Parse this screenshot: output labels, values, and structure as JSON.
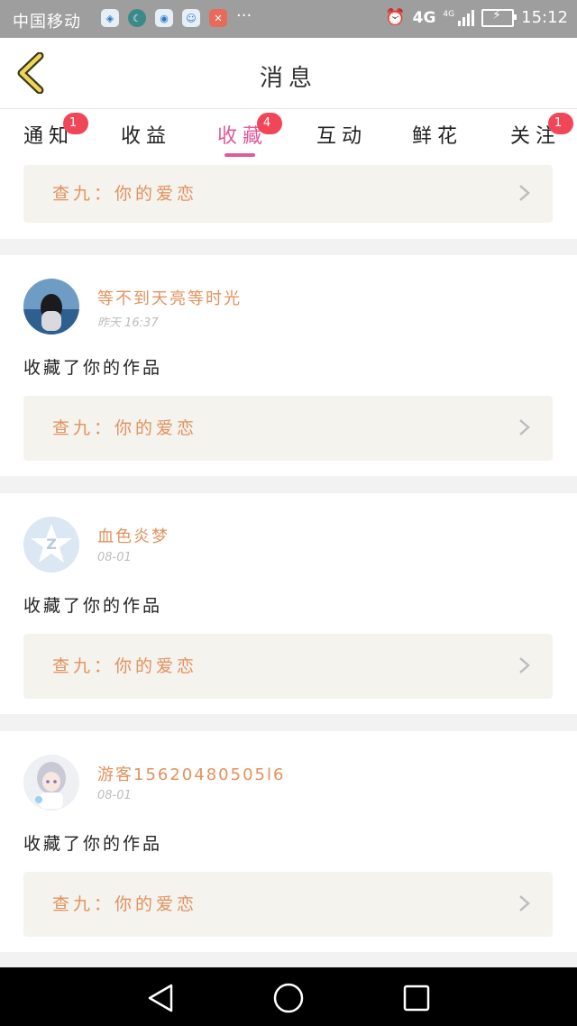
{
  "status_bar": {
    "carrier": "中国移动",
    "network": "4G",
    "network_small": "4G",
    "time": "15:12"
  },
  "header": {
    "title": "消息"
  },
  "tabs": [
    {
      "label": "通知",
      "badge": "1"
    },
    {
      "label": "收益",
      "badge": ""
    },
    {
      "label": "收藏",
      "badge": "4",
      "active": true
    },
    {
      "label": "互动",
      "badge": ""
    },
    {
      "label": "鲜花",
      "badge": ""
    },
    {
      "label": "关注",
      "badge": "1"
    }
  ],
  "items": [
    {
      "work_title": "查九：你的爱恋"
    },
    {
      "username": "等不到天亮等时光",
      "time": "昨天 16:37",
      "action": "收藏了你的作品",
      "work_title": "查九：你的爱恋"
    },
    {
      "username": "血色炎梦",
      "time": "08-01",
      "action": "收藏了你的作品",
      "work_title": "查九：你的爱恋"
    },
    {
      "username": "游客15620480505l6",
      "time": "08-01",
      "action": "收藏了你的作品",
      "work_title": "查九：你的爱恋"
    }
  ],
  "colors": {
    "accent_pink": "#e05a9a",
    "badge_red": "#f14658",
    "username_orange": "#e3915d",
    "work_bg": "#f4f3ee"
  }
}
